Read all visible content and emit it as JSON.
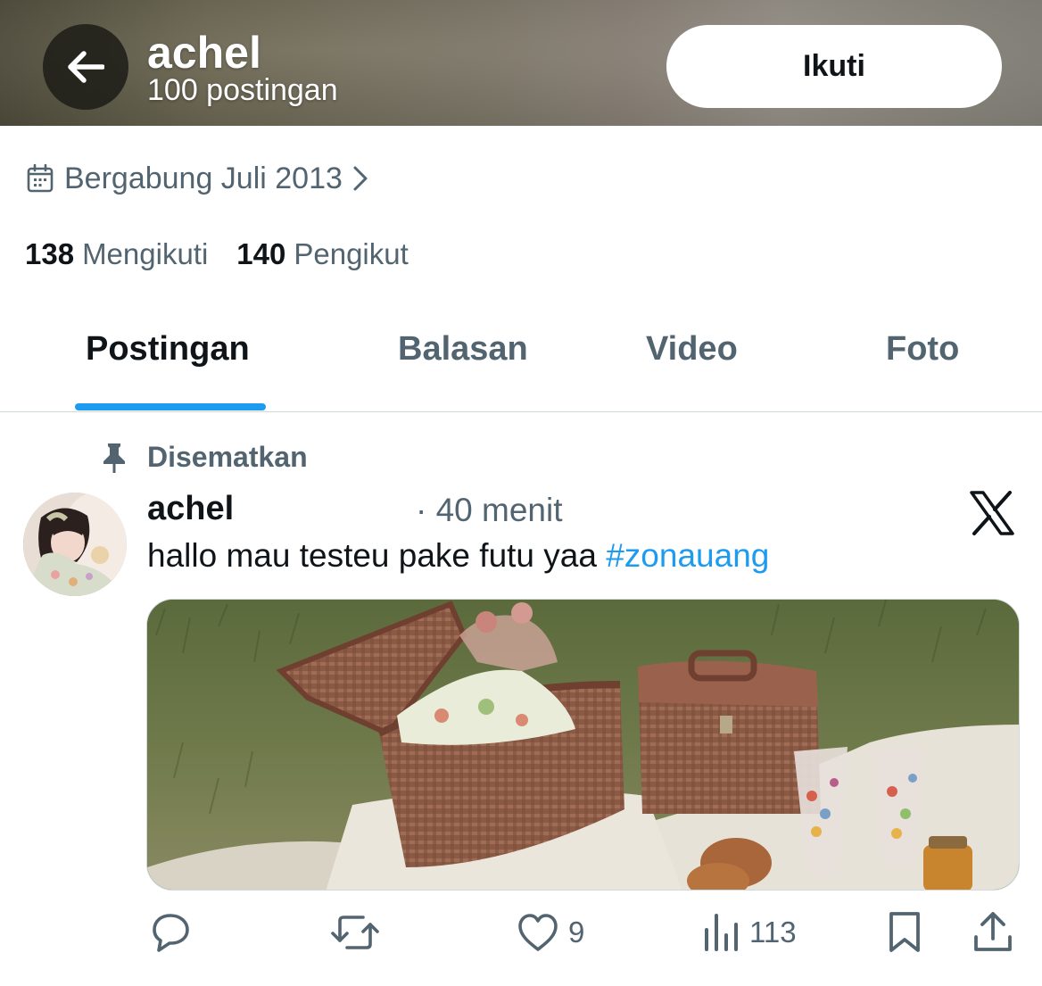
{
  "header": {
    "back_icon": "arrow-left-icon",
    "name": "achel",
    "post_count": "100 postingan",
    "follow_label": "Ikuti"
  },
  "profile": {
    "joined_icon": "calendar-icon",
    "joined": "Bergabung Juli 2013",
    "following_count": "138",
    "following_label": "Mengikuti",
    "followers_count": "140",
    "followers_label": "Pengikut"
  },
  "tabs": [
    {
      "label": "Postingan",
      "active": true
    },
    {
      "label": "Balasan",
      "active": false
    },
    {
      "label": "Video",
      "active": false
    },
    {
      "label": "Foto",
      "active": false
    }
  ],
  "post": {
    "pinned_label": "Disematkan",
    "author": "achel",
    "time": "· 40 menit",
    "text": "hallo mau testeu pake futu yaa ",
    "hashtag": "#zonauang",
    "likes": "9",
    "views": "113"
  },
  "colors": {
    "accent": "#1d9bf0",
    "secondary_text": "#536471",
    "primary_text": "#0f1419"
  }
}
